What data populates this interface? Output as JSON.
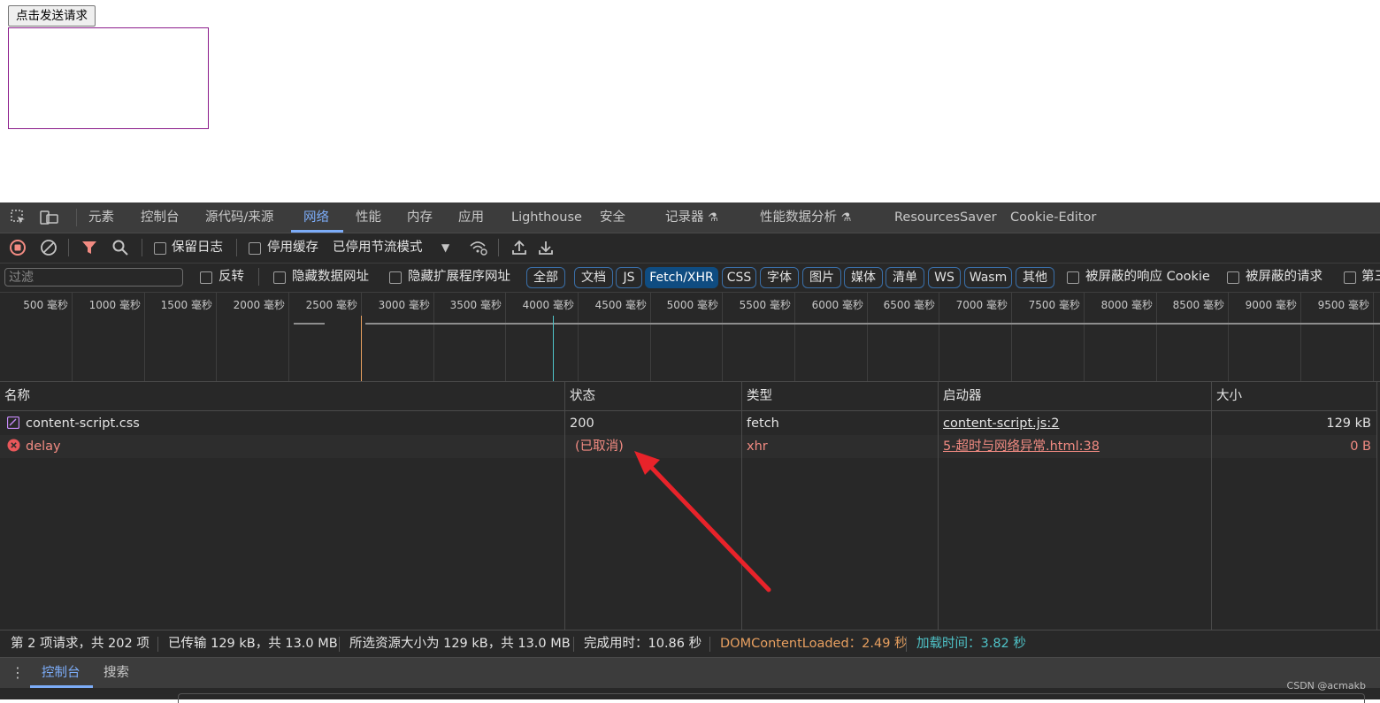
{
  "page": {
    "button_label": "点击发送请求"
  },
  "devtools": {
    "tabs": [
      "元素",
      "控制台",
      "源代码/来源",
      "网络",
      "性能",
      "内存",
      "应用",
      "Lighthouse",
      "安全",
      "记录器",
      "性能数据分析",
      "ResourcesSaver",
      "Cookie-Editor"
    ],
    "active_tab": "网络",
    "toolbar": {
      "preserve_log": "保留日志",
      "disable_cache": "停用缓存",
      "throttling": "已停用节流模式"
    },
    "filterbar": {
      "filter_placeholder": "过滤",
      "invert": "反转",
      "hide_data_urls": "隐藏数据网址",
      "hide_ext_urls": "隐藏扩展程序网址",
      "types": [
        "全部",
        "文档",
        "JS",
        "Fetch/XHR",
        "CSS",
        "字体",
        "图片",
        "媒体",
        "清单",
        "WS",
        "Wasm",
        "其他"
      ],
      "selected_type": "Fetch/XHR",
      "blocked_cookies": "被屏蔽的响应 Cookie",
      "blocked_requests": "被屏蔽的请求",
      "third_party": "第三"
    },
    "overview": {
      "ticks": [
        "500 毫秒",
        "1000 毫秒",
        "1500 毫秒",
        "2000 毫秒",
        "2500 毫秒",
        "3000 毫秒",
        "3500 毫秒",
        "4000 毫秒",
        "4500 毫秒",
        "5000 毫秒",
        "5500 毫秒",
        "6000 毫秒",
        "6500 毫秒",
        "7000 毫秒",
        "7500 毫秒",
        "8000 毫秒",
        "8500 毫秒",
        "9000 毫秒",
        "9500 毫秒"
      ],
      "dom_content_loaded_color": "#e8a060",
      "load_color": "#4fc3c8"
    },
    "table": {
      "columns": [
        "名称",
        "状态",
        "类型",
        "启动器",
        "大小"
      ],
      "rows": [
        {
          "name": "content-script.css",
          "status": "200",
          "type": "fetch",
          "initiator": "content-script.js:2",
          "size": "129 kB",
          "error": false
        },
        {
          "name": "delay",
          "status": "(已取消)",
          "type": "xhr",
          "initiator": "5-超时与网络异常.html:38",
          "size": "0 B",
          "error": true
        }
      ]
    },
    "status_bar": {
      "requests": "第 2 项请求，共 202 项",
      "transferred": "已传输 129 kB，共 13.0 MB",
      "resources": "所选资源大小为 129 kB，共 13.0 MB",
      "finish": "完成用时：10.86 秒",
      "dom_content_loaded": "DOMContentLoaded：2.49 秒",
      "load": "加载时间：3.82 秒",
      "dcl_color": "#e8a060",
      "load_color": "#4fc3c8"
    },
    "drawer": {
      "tabs": [
        "控制台",
        "搜索"
      ],
      "active_tab": "控制台"
    }
  },
  "watermark": "CSDN @acmakb",
  "annotation_color": "#e8232a"
}
